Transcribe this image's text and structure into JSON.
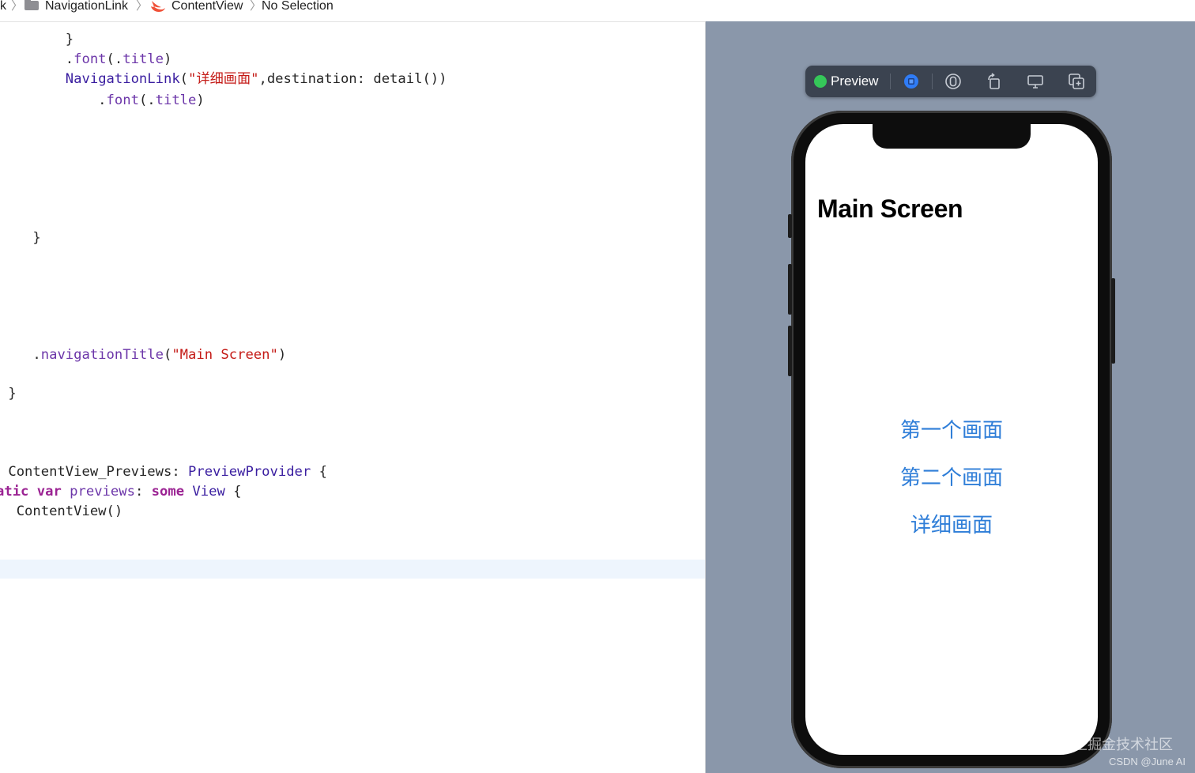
{
  "breadcrumb": {
    "items": [
      "k",
      "NavigationLink",
      "ContentView",
      "No Selection"
    ],
    "separator": "〉",
    "icons": [
      "folder-icon",
      "swift-file-icon"
    ]
  },
  "editor": {
    "lines": [
      {
        "parts": [
          {
            "t": "        }",
            "c": ""
          }
        ]
      },
      {
        "parts": [
          {
            "t": "        .",
            "c": ""
          },
          {
            "t": "font",
            "c": "fn"
          },
          {
            "t": "(.",
            "c": ""
          },
          {
            "t": "title",
            "c": "fn"
          },
          {
            "t": ")",
            "c": ""
          }
        ]
      },
      {
        "parts": [
          {
            "t": "        ",
            "c": ""
          },
          {
            "t": "NavigationLink",
            "c": "tp"
          },
          {
            "t": "(",
            "c": ""
          },
          {
            "t": "\"详细画面\"",
            "c": "str"
          },
          {
            "t": ",destination: ",
            "c": ""
          },
          {
            "t": "detail",
            "c": ""
          },
          {
            "t": "())",
            "c": ""
          }
        ]
      },
      {
        "parts": [
          {
            "t": "            .",
            "c": ""
          },
          {
            "t": "font",
            "c": "fn"
          },
          {
            "t": "(.",
            "c": ""
          },
          {
            "t": "title",
            "c": "fn"
          },
          {
            "t": ")",
            "c": ""
          }
        ]
      },
      {
        "parts": [
          {
            "t": "    }",
            "c": ""
          }
        ]
      },
      {
        "parts": [
          {
            "t": "    .",
            "c": ""
          },
          {
            "t": "navigationTitle",
            "c": "fn"
          },
          {
            "t": "(",
            "c": ""
          },
          {
            "t": "\"Main Screen\"",
            "c": "str"
          },
          {
            "t": ")",
            "c": ""
          }
        ]
      },
      {
        "parts": [
          {
            "t": " }",
            "c": ""
          }
        ]
      },
      {
        "parts": [
          {
            "t": " ContentView_Previews",
            "c": ""
          },
          {
            "t": ": ",
            "c": ""
          },
          {
            "t": "PreviewProvider",
            "c": "tp"
          },
          {
            "t": " {",
            "c": ""
          }
        ]
      },
      {
        "parts": [
          {
            "t": "atic ",
            "c": "kw"
          },
          {
            "t": "var ",
            "c": "kw"
          },
          {
            "t": "previews",
            "c": "fn"
          },
          {
            "t": ": ",
            "c": ""
          },
          {
            "t": "some ",
            "c": "kw"
          },
          {
            "t": "View",
            "c": "tp"
          },
          {
            "t": " {",
            "c": ""
          }
        ]
      },
      {
        "parts": [
          {
            "t": "  ContentView()",
            "c": ""
          }
        ]
      }
    ]
  },
  "preview_toolbar": {
    "label": "Preview",
    "status_color": "#35c759",
    "buttons": [
      "live-preview-icon",
      "inspect-preview-icon",
      "rotate-device-icon",
      "device-settings-icon",
      "duplicate-preview-icon"
    ]
  },
  "phone": {
    "nav_title": "Main Screen",
    "links": [
      "第一个画面",
      "第二个画面",
      "详细画面"
    ],
    "link_color": "#2f7ed8"
  },
  "watermark": {
    "line1": "@稀土掘金技术社区",
    "line2": "CSDN @June AI"
  }
}
